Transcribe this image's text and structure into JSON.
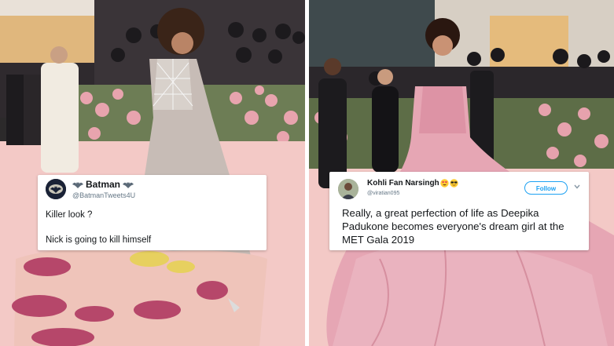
{
  "left_tweet": {
    "display_name": "Batman",
    "handle": "@BatmanTweets4U",
    "line1": "Killer look ?",
    "line2": "Nick is going to kill himself",
    "name_emblem_icon": "bat-symbol-icon"
  },
  "right_tweet": {
    "display_name": "Kohli Fan Narsingh",
    "handle": "@viratian095",
    "follow_label": "Follow",
    "text": "Really, a great perfection of life as Deepika Padukone becomes everyone's dream girl at the MET Gala 2019",
    "name_emojis": [
      "heart-eyes-emoji-icon",
      "sunglasses-emoji-icon"
    ]
  },
  "colors": {
    "carpet_pink": "#f3c9c6",
    "tweet_bg": "#ffffff",
    "follow_blue": "#1da1f2",
    "handle_gray": "#657786"
  }
}
